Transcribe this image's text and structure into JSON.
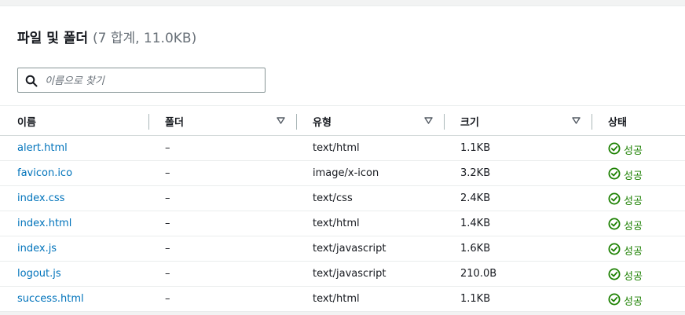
{
  "section": {
    "title": "파일 및 폴더",
    "count": "(7 합계, 11.0KB)"
  },
  "search": {
    "placeholder": "이름으로 찾기"
  },
  "columns": {
    "name": "이름",
    "folder": "폴더",
    "type": "유형",
    "size": "크기",
    "status": "상태"
  },
  "rows": [
    {
      "name": "alert.html",
      "folder": "–",
      "type": "text/html",
      "size": "1.1KB",
      "status": "성공"
    },
    {
      "name": "favicon.ico",
      "folder": "–",
      "type": "image/x-icon",
      "size": "3.2KB",
      "status": "성공"
    },
    {
      "name": "index.css",
      "folder": "–",
      "type": "text/css",
      "size": "2.4KB",
      "status": "성공"
    },
    {
      "name": "index.html",
      "folder": "–",
      "type": "text/html",
      "size": "1.4KB",
      "status": "성공"
    },
    {
      "name": "index.js",
      "folder": "–",
      "type": "text/javascript",
      "size": "1.6KB",
      "status": "성공"
    },
    {
      "name": "logout.js",
      "folder": "–",
      "type": "text/javascript",
      "size": "210.0B",
      "status": "성공"
    },
    {
      "name": "success.html",
      "folder": "–",
      "type": "text/html",
      "size": "1.1KB",
      "status": "성공"
    }
  ],
  "colors": {
    "link": "#0073bb",
    "success": "#1d8102"
  },
  "icons": {
    "search": "search-icon",
    "sort": "sort-triangle-icon",
    "status": "check-circle-icon"
  }
}
